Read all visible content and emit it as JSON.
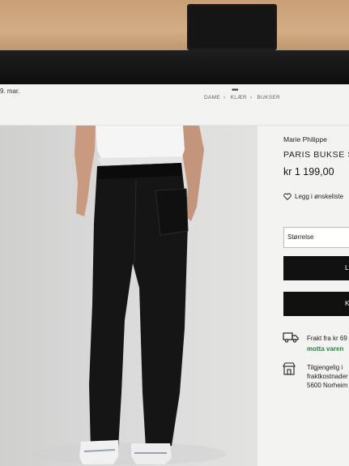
{
  "status": {
    "date": "9. mar."
  },
  "breadcrumb": [
    "DAME",
    "KLÆR",
    "BUKSER"
  ],
  "product": {
    "brand": "Marie Philippe",
    "title": "PARIS BUKSE S",
    "price": "kr 1 199,00",
    "wishlist_label": "Legg i ønskeliste",
    "size_label": "Størrelse",
    "primary_button": "L",
    "secondary_button": "KL"
  },
  "shipping": {
    "line1": "Frakt fra kr 69",
    "line2": "motta varen",
    "link_color": "#2f7d4a"
  },
  "store": {
    "line1": "Tilgjengelig i",
    "line2": "fraktkostnader",
    "line3": "5600 Norheim"
  },
  "icons": [
    "heart-icon",
    "truck-icon",
    "store-icon"
  ]
}
